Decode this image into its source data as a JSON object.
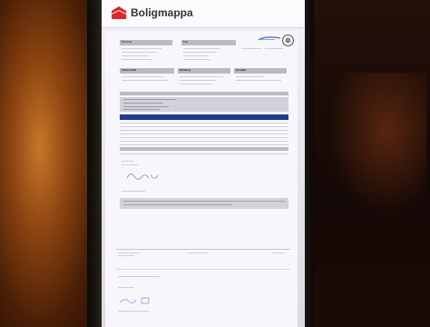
{
  "app": {
    "title": "Boligmappa",
    "brand_color": "#e0262b"
  },
  "document": {
    "sections": {
      "col1": "Til / Fra",
      "col2": "Fra",
      "col3": "Kontakt",
      "col4": "Virksomhet",
      "col5": "Befaring",
      "col6": "Sluttkontroll",
      "col7": "Signatur"
    },
    "accent_color": "#1f3c8a"
  },
  "icons": {
    "logo": "boligmappa-logo-icon",
    "close": "close-icon"
  }
}
